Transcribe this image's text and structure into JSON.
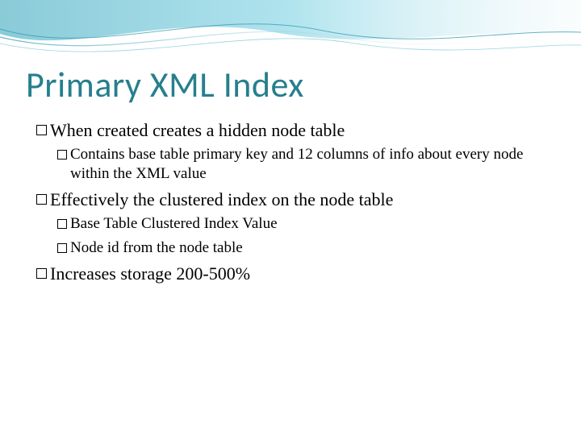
{
  "title": "Primary XML Index",
  "bullets": {
    "b1": "When created creates a hidden node table",
    "b1_1": "Contains base table primary key and 12 columns of info about every node within the XML value",
    "b2": "Effectively the clustered index on the node table",
    "b2_1": "Base Table Clustered Index Value",
    "b2_2": "Node id from the node table",
    "b3": "Increases storage 200-500%"
  },
  "accent_color": "#267f8d"
}
